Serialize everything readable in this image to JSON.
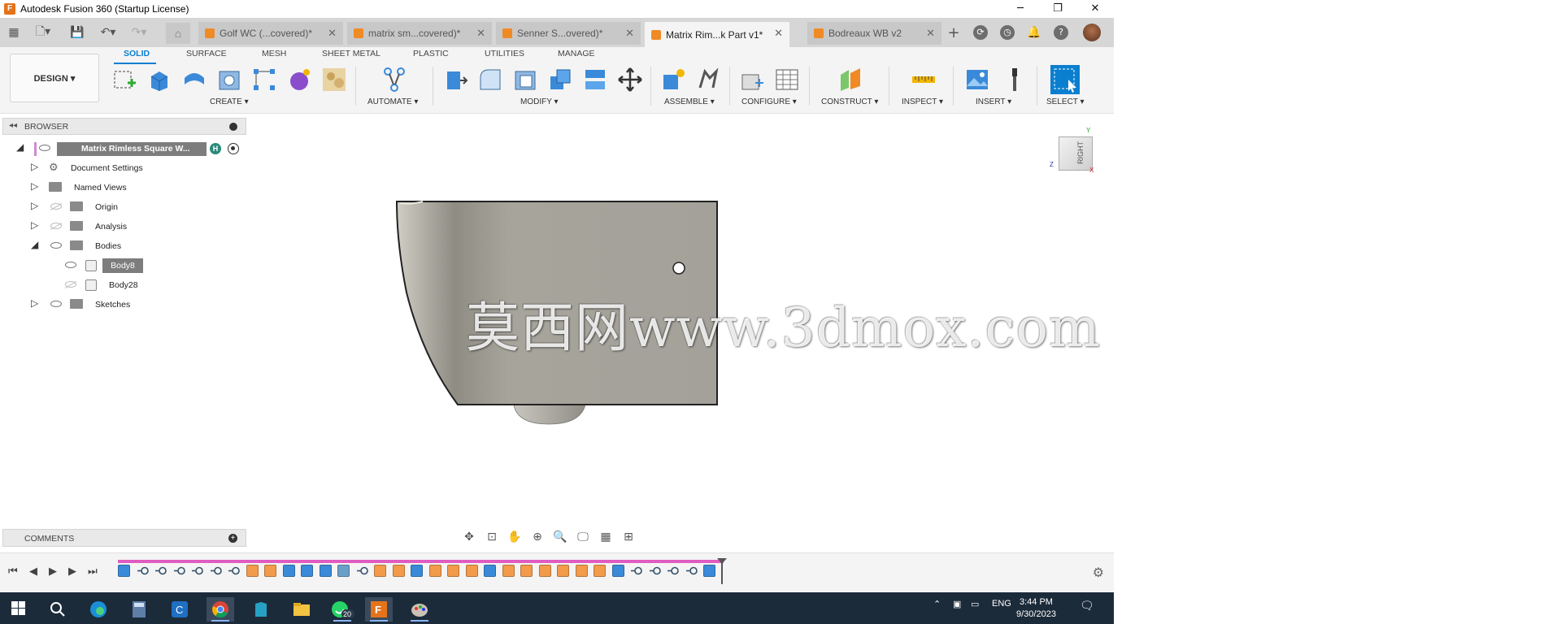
{
  "window": {
    "title": "Autodesk Fusion 360 (Startup License)",
    "controls": {
      "minimize": "─",
      "restore": "❐",
      "close": "✕"
    }
  },
  "tabs": [
    {
      "label": "Golf WC (...covered)*",
      "active": false
    },
    {
      "label": "matrix sm...covered)*",
      "active": false
    },
    {
      "label": "Senner S...overed)*",
      "active": false
    },
    {
      "label": "Matrix Rim...k Part v1*",
      "active": true
    },
    {
      "label": "Bodreaux WB v2",
      "active": false
    }
  ],
  "toolbar": {
    "workspace": "DESIGN ▾",
    "workspace_tabs": [
      "SOLID",
      "SURFACE",
      "MESH",
      "SHEET METAL",
      "PLASTIC",
      "UTILITIES",
      "MANAGE"
    ],
    "groups": {
      "create": "CREATE ▾",
      "automate": "AUTOMATE ▾",
      "modify": "MODIFY ▾",
      "assemble": "ASSEMBLE ▾",
      "configure": "CONFIGURE ▾",
      "construct": "CONSTRUCT ▾",
      "inspect": "INSPECT ▾",
      "insert": "INSERT ▾",
      "select": "SELECT ▾"
    }
  },
  "browser": {
    "title": "BROWSER",
    "root": "Matrix Rimless Square W...",
    "root_badge": "H",
    "items": {
      "document_settings": "Document Settings",
      "named_views": "Named Views",
      "origin": "Origin",
      "analysis": "Analysis",
      "bodies": "Bodies",
      "body8": "Body8",
      "body28": "Body28",
      "sketches": "Sketches"
    }
  },
  "viewcube": {
    "face": "RIGHT",
    "y": "Y",
    "z": "Z",
    "x": "X"
  },
  "watermark": "莫西网www.3dmox.com",
  "comments": {
    "title": "COMMENTS"
  },
  "taskbar": {
    "whatsapp_badge": "20",
    "language": "ENG",
    "time": "3:44 PM",
    "date": "9/30/2023"
  }
}
